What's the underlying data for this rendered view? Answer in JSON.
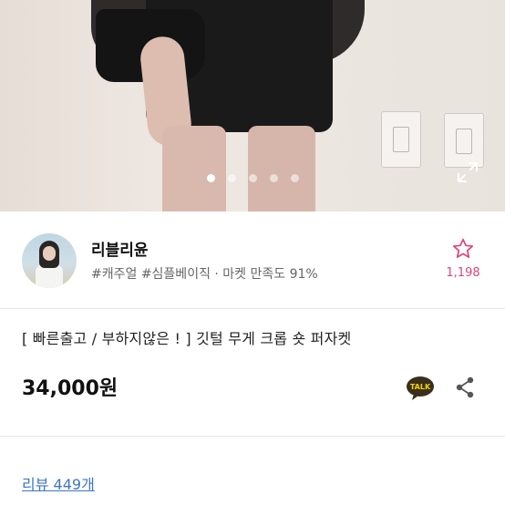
{
  "gallery": {
    "dot_count": 5,
    "active_index": 0,
    "icons": [
      "expand-icon"
    ]
  },
  "seller": {
    "name": "리블리윤",
    "tags": "#캐주얼 #심플베이직 · 마켓 만족도 91%",
    "favorite_count": "1,198",
    "favorite_color": "#e0457b"
  },
  "product": {
    "title": "[ 빠른출고 / 부하지않은 ! ] 깃털 무게 크롭 숏 퍼자켓",
    "price": "34,000원",
    "talk_badge": "TALK"
  },
  "reviews": {
    "link_label": "리뷰 449개",
    "link_color": "#3d74c6"
  }
}
